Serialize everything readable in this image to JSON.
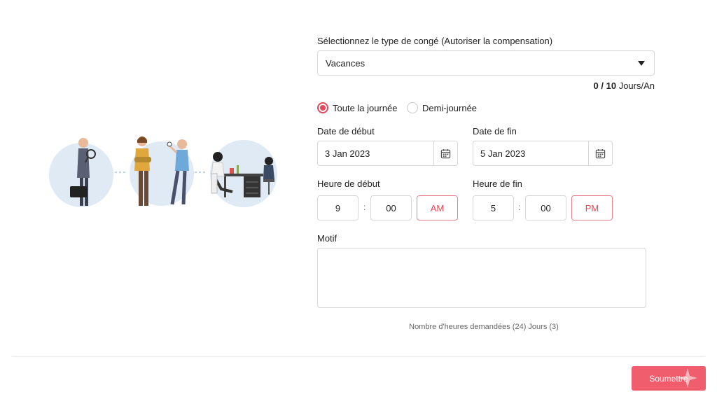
{
  "leave_type": {
    "label": "Sélectionnez le type de congé (Autoriser la compensation)",
    "selected": "Vacances",
    "quota_used": "0",
    "quota_sep": " / ",
    "quota_total": "10",
    "quota_unit": " Jours/An"
  },
  "duration": {
    "options": [
      {
        "label": "Toute la journée",
        "selected": true
      },
      {
        "label": "Demi-journée",
        "selected": false
      }
    ]
  },
  "dates": {
    "start_label": "Date de début",
    "start_value": "3 Jan 2023",
    "end_label": "Date de fin",
    "end_value": "5 Jan 2023"
  },
  "times": {
    "start_label": "Heure de début",
    "start_hour": "9",
    "start_minute": "00",
    "start_period": "AM",
    "end_label": "Heure de fin",
    "end_hour": "5",
    "end_minute": "00",
    "end_period": "PM",
    "separator": ":"
  },
  "reason": {
    "label": "Motif",
    "value": ""
  },
  "summary": {
    "text": "Nombre d'heures demandées (24) Jours (3)"
  },
  "actions": {
    "submit_label": "Soumettre"
  },
  "colors": {
    "accent": "#e5485a",
    "submit_bg": "#f05d6d",
    "border": "#d7d7d7",
    "illustration_circle": "#dfeaf5"
  },
  "icons": [
    "caret-down-icon",
    "calendar-icon",
    "sparkle-icon",
    "workflow-illustration"
  ]
}
